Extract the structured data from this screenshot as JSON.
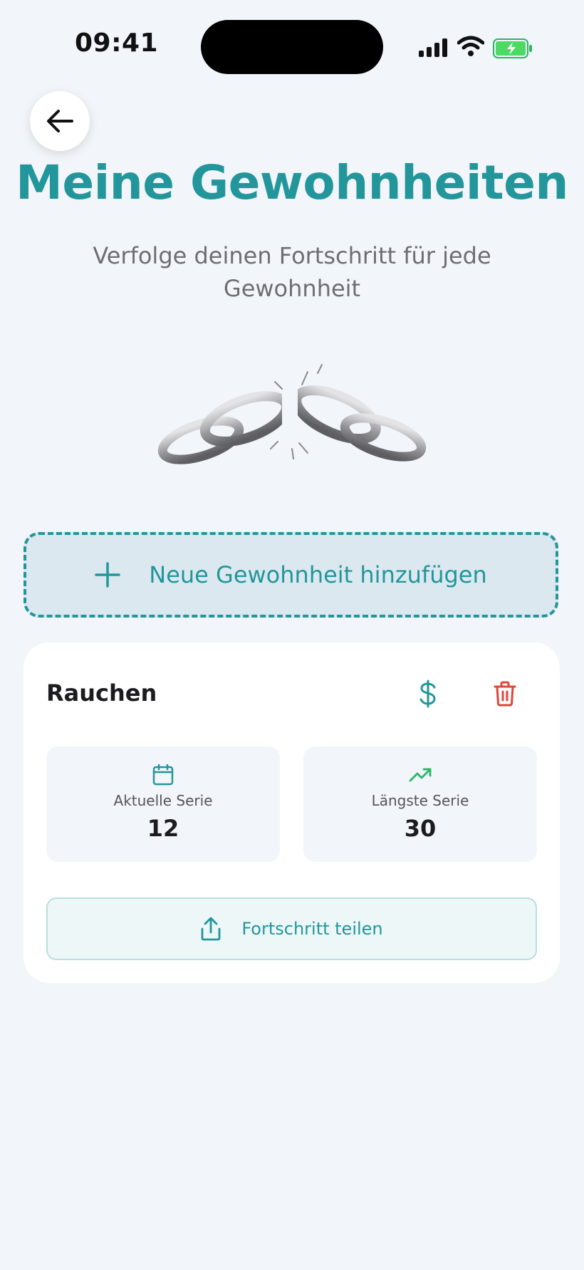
{
  "status_bar": {
    "time": "09:41"
  },
  "header": {
    "title": "Meine Gewohnheiten",
    "subtitle": "Verfolge deinen Fortschritt für jede Gewohnheit"
  },
  "add_habit": {
    "label": "Neue Gewohnheit hinzufügen",
    "icon": "plus-icon"
  },
  "habit": {
    "name": "Rauchen",
    "actions": [
      "dollar-icon",
      "trash-icon"
    ],
    "stats": {
      "current": {
        "label": "Aktuelle Serie",
        "value": "12",
        "icon": "calendar-icon"
      },
      "longest": {
        "label": "Längste Serie",
        "value": "30",
        "icon": "trending-up-icon"
      }
    },
    "share_label": "Fortschritt teilen"
  },
  "colors": {
    "accent": "#23969b",
    "danger": "#e0453b",
    "success": "#2bb566",
    "background": "#f2f5fa"
  }
}
